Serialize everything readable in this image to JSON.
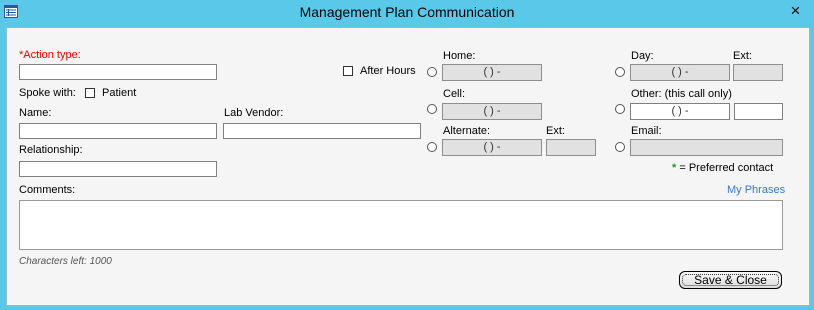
{
  "window": {
    "title": "Management Plan Communication",
    "close_glyph": "×"
  },
  "form": {
    "action_type": {
      "required_mark": "*",
      "label": "Action type:",
      "value": ""
    },
    "after_hours_label": "After Hours",
    "spoke_with_label": "Spoke with:",
    "patient_label": "Patient",
    "name_label": "Name:",
    "lab_vendor_label": "Lab Vendor:",
    "relationship_label": "Relationship:",
    "comments_label": "Comments:",
    "my_phrases_link": "My Phrases",
    "chars_left": "Characters left: 1000",
    "save_close_button": "Save & Close"
  },
  "contacts": {
    "home_label": "Home:",
    "home_value": "(   )   -",
    "cell_label": "Cell:",
    "cell_value": "(   )   -",
    "alternate_label": "Alternate:",
    "alternate_value": "(   )   -",
    "alternate_ext_label": "Ext:",
    "day_label": "Day:",
    "day_value": "(   )   -",
    "day_ext_label": "Ext:",
    "other_label": "Other: (this call only)",
    "other_value": "(   )   -",
    "email_label": "Email:",
    "preferred_star": "*",
    "preferred_text": "= Preferred contact"
  },
  "colors": {
    "titlebar": "#5ac8e8",
    "required": "#e60000",
    "link": "#3a78c8",
    "preferred_star": "#1a9c1a"
  },
  "icons": {
    "app": "form-list-icon",
    "close": "close-icon"
  }
}
